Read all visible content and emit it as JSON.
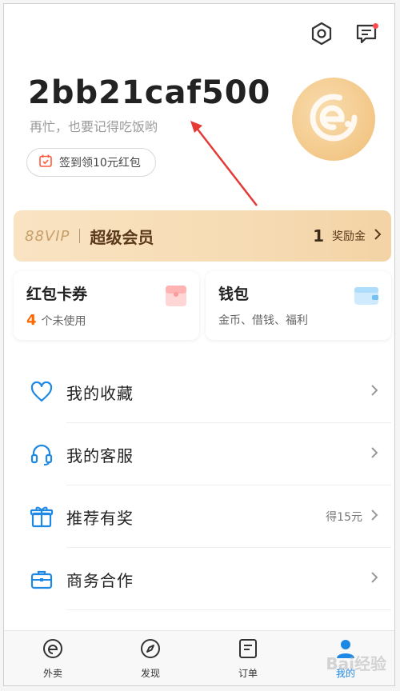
{
  "header": {
    "username": "2bb21caf500",
    "subtitle": "再忙，也要记得吃饭哟",
    "signin_label": "签到领10元红包"
  },
  "vip": {
    "badge": "88VIP",
    "title": "超级会员",
    "count": "1",
    "label": "奖励金"
  },
  "cards": [
    {
      "title": "红包卡券",
      "count": "4",
      "subtitle": "个未使用"
    },
    {
      "title": "钱包",
      "subtitle": "金币、借钱、福利"
    }
  ],
  "menu": [
    {
      "label": "我的收藏",
      "right_text": "",
      "icon": "heart-icon"
    },
    {
      "label": "我的客服",
      "right_text": "",
      "icon": "headset-icon"
    },
    {
      "label": "推荐有奖",
      "right_text": "得15元",
      "icon": "gift-icon"
    },
    {
      "label": "商务合作",
      "right_text": "",
      "icon": "briefcase-icon"
    }
  ],
  "tabbar": [
    {
      "label": "外卖",
      "icon": "takeout-icon",
      "active": false
    },
    {
      "label": "发现",
      "icon": "compass-icon",
      "active": false
    },
    {
      "label": "订单",
      "icon": "order-icon",
      "active": false
    },
    {
      "label": "我的",
      "icon": "profile-icon",
      "active": true
    }
  ],
  "colors": {
    "accent_blue": "#1e88e5",
    "vip_gold": "#f6dcb4",
    "highlight_orange": "#ff6a00",
    "annotation_red": "#e53935"
  },
  "watermark": "Bai经验"
}
